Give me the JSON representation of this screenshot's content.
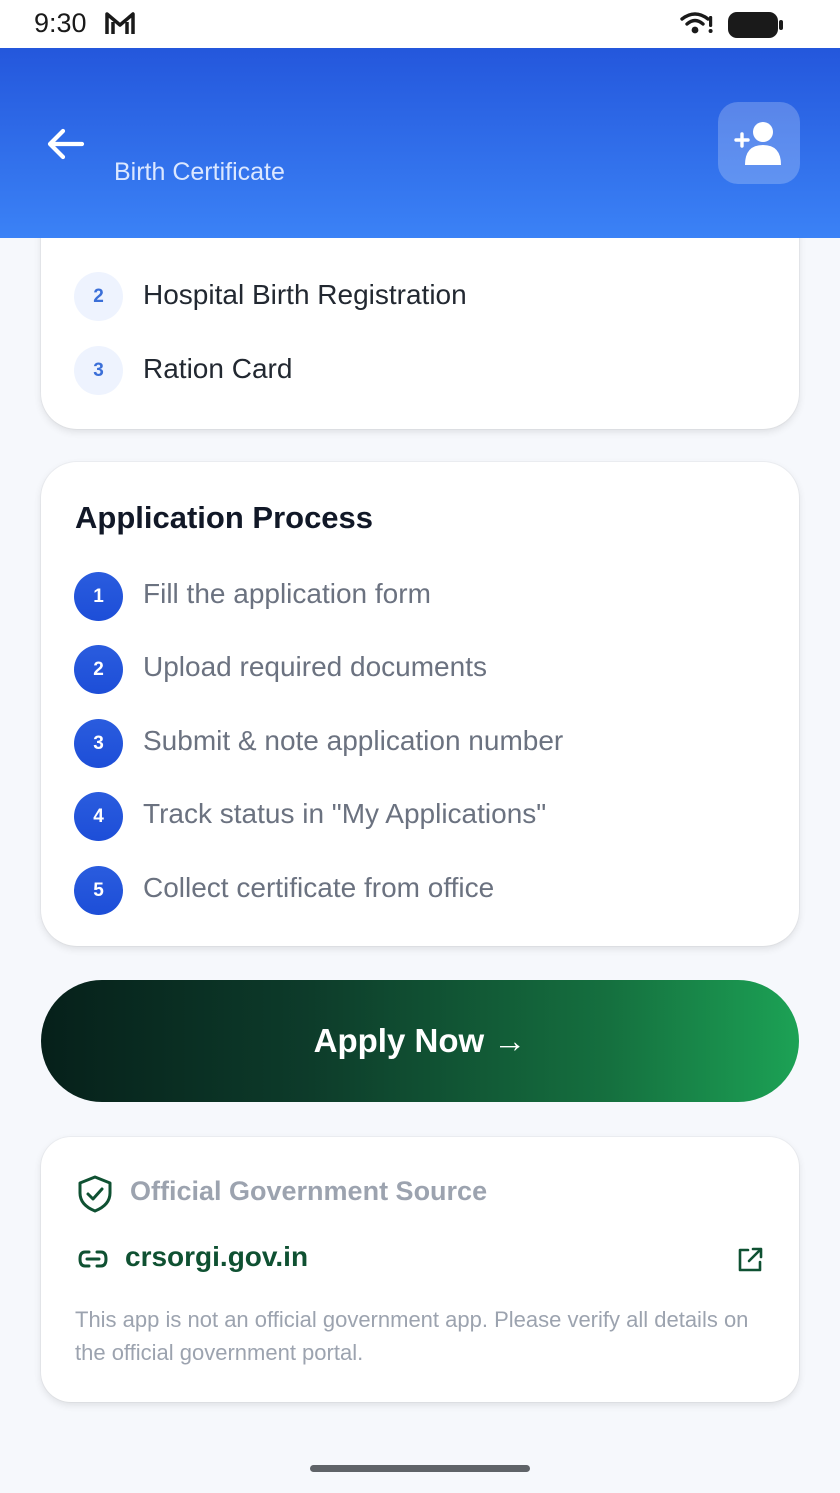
{
  "status_bar": {
    "time": "9:30",
    "icons": [
      "gmail-icon",
      "wifi-icon",
      "battery-icon"
    ]
  },
  "header": {
    "title": "Birth Certificate",
    "back_icon": "arrow-left-icon",
    "profile_icon": "add-person-icon",
    "gradient": [
      "#2457dc",
      "#3b82f6"
    ]
  },
  "documents": {
    "items": [
      {
        "number": "2",
        "label": "Hospital Birth Registration"
      },
      {
        "number": "3",
        "label": "Ration Card"
      }
    ]
  },
  "process": {
    "title": "Application Process",
    "steps": [
      {
        "number": "1",
        "label": "Fill the application form"
      },
      {
        "number": "2",
        "label": "Upload required documents"
      },
      {
        "number": "3",
        "label": "Submit & note application number"
      },
      {
        "number": "4",
        "label": "Track status in \"My Applications\""
      },
      {
        "number": "5",
        "label": "Collect certificate from office"
      }
    ]
  },
  "apply_button": {
    "label": "Apply Now →",
    "gradient": [
      "#06201a",
      "#1ca255"
    ]
  },
  "source": {
    "title": "Official Government Source",
    "link": "crsorgi.gov.in",
    "disclaimer": "This app is not an official government app. Please verify all details on the official government portal.",
    "accent_color": "#0f5132"
  }
}
